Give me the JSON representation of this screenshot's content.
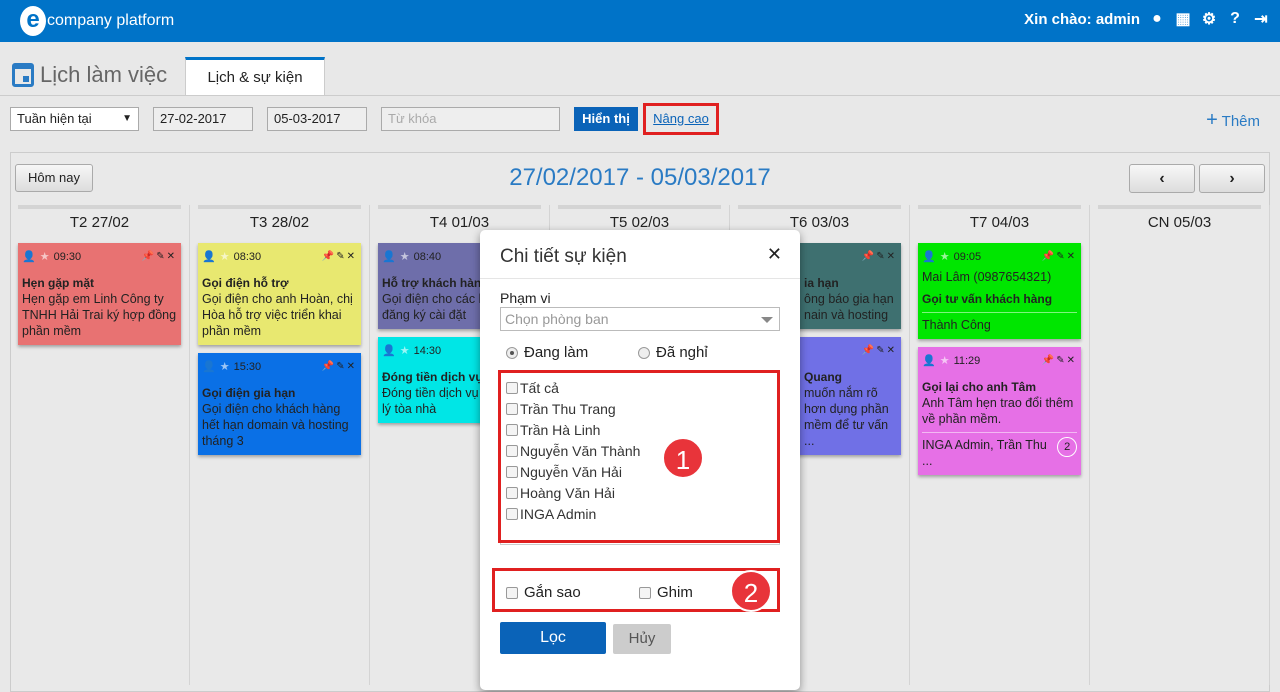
{
  "header": {
    "logo": "company platform",
    "greeting": "Xin chào: admin",
    "icons": [
      "user-circle-icon",
      "apps-grid-icon",
      "gear-icon",
      "help-icon",
      "logout-icon"
    ],
    "color": "#0073c8"
  },
  "page": {
    "title": "Lịch làm việc",
    "tab": "Lịch & sự kiện"
  },
  "toolbar": {
    "period": "Tuần hiện tại",
    "from": "27-02-2017",
    "to": "05-03-2017",
    "keyword_placeholder": "Từ khóa",
    "show": "Hiển thị",
    "advanced": "Nâng cao",
    "add": "Thêm"
  },
  "calendar": {
    "today": "Hôm nay",
    "range": "27/02/2017 - 05/03/2017",
    "prev": "‹",
    "next": "›",
    "days": [
      {
        "label": "T2 27/02",
        "events": [
          {
            "time": "09:30",
            "title": "Hẹn gặp mặt",
            "desc": "Hẹn gặp em Linh Công ty TNHH Hải Trai ký hợp đồng phần mềm",
            "color": "#e87272"
          }
        ]
      },
      {
        "label": "T3 28/02",
        "events": [
          {
            "time": "08:30",
            "title": "Gọi điện hỗ trợ",
            "desc": "Gọi điện cho anh Hoàn, chị Hòa hỗ trợ việc triển khai phần mềm",
            "color": "#e8e870"
          },
          {
            "time": "15:30",
            "title": "Gọi điện gia hạn",
            "desc": "Gọi điện cho khách hàng hết hạn domain và hosting tháng 3",
            "color": "#0a70e6"
          }
        ]
      },
      {
        "label": "T4 01/03",
        "events": [
          {
            "time": "08:40",
            "title": "Hỗ trợ khách hàng",
            "desc": "Gọi điện cho các k… đã đăng ký cài đặt",
            "color": "#6e6eaa"
          },
          {
            "time": "14:30",
            "title": "Đóng tiền dịch vụ",
            "desc": "Đóng tiền dịch vụ c… quản lý tòa nhà",
            "color": "#00e6e6"
          }
        ]
      },
      {
        "label": "T5 02/03",
        "events": []
      },
      {
        "label": "T6 03/03",
        "events": [
          {
            "time": "",
            "title": "ia hạn",
            "desc": "ông báo gia hạn nain và hosting",
            "color": "#3e7070"
          },
          {
            "time": "",
            "title": "Quang",
            "desc": "muốn nắm rõ hơn dụng phần mềm để tư vấn ...",
            "color": "#7070e6"
          }
        ]
      },
      {
        "label": "T7 04/03",
        "events": [
          {
            "time": "09:05",
            "contact": "Mai Lâm (0987654321)",
            "title": "Gọi tư vấn khách hàng",
            "footer": "Thành Công",
            "color": "#00e600"
          },
          {
            "time": "11:29",
            "title": "Gọi lại cho anh Tâm",
            "desc": "Anh Tâm hẹn trao đổi thêm về phần mềm.",
            "footer": "INGA Admin, Trần Thu ...",
            "count": "2",
            "color": "#e670e6"
          }
        ]
      },
      {
        "label": "CN 05/03",
        "events": []
      }
    ]
  },
  "modal": {
    "title": "Chi tiết sự kiện",
    "scope_label": "Phạm vi",
    "scope_placeholder": "Chọn phòng ban",
    "radio_active": "Đang làm",
    "radio_left": "Đã nghỉ",
    "people": [
      "Tất cả",
      "Trần Thu Trang",
      "Trần Hà Linh",
      "Nguyễn Văn Thành",
      "Nguyễn Văn Hải",
      "Hoàng Văn Hải",
      "INGA Admin"
    ],
    "starred": "Gắn sao",
    "pinned": "Ghim",
    "filter": "Lọc",
    "cancel": "Hủy",
    "marker1": "1",
    "marker2": "2"
  }
}
